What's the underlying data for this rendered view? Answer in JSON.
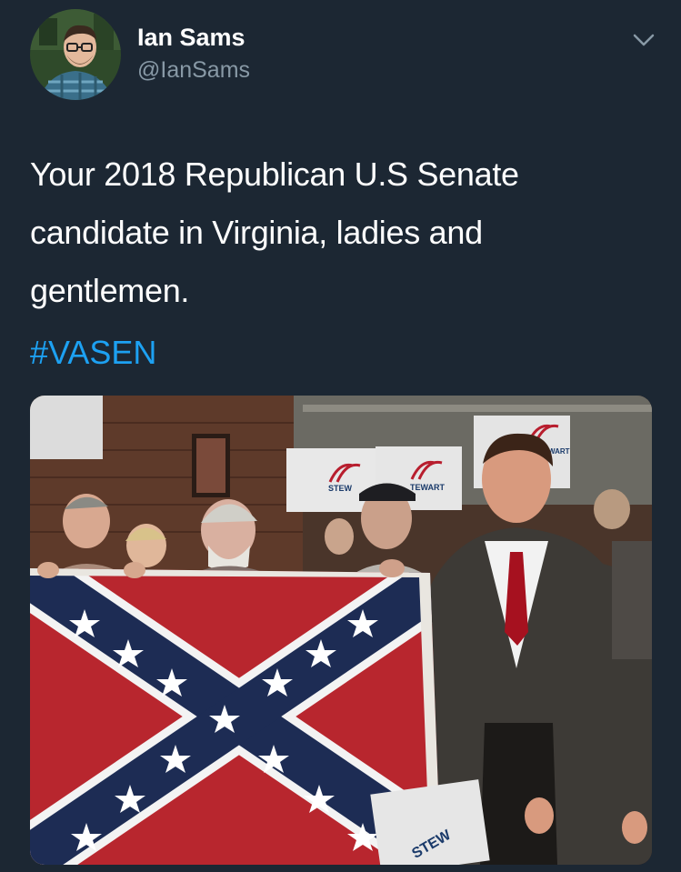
{
  "author": {
    "display_name": "Ian Sams",
    "handle": "@IanSams",
    "avatar_icon": "profile-photo"
  },
  "menu": {
    "icon": "chevron-down-icon"
  },
  "tweet": {
    "text": "Your 2018 Republican U.S Senate candidate in Virginia, ladies and gentlemen.",
    "hashtag": "#VASEN"
  },
  "media": {
    "description_icon": "photo",
    "sign_text_1": "STEW",
    "sign_text_2": "TEWART",
    "sign_text_3": "WART",
    "sign_text_4": "STEW"
  },
  "colors": {
    "background": "#1c2733",
    "secondary_text": "#8899a6",
    "link": "#1da1f2"
  }
}
